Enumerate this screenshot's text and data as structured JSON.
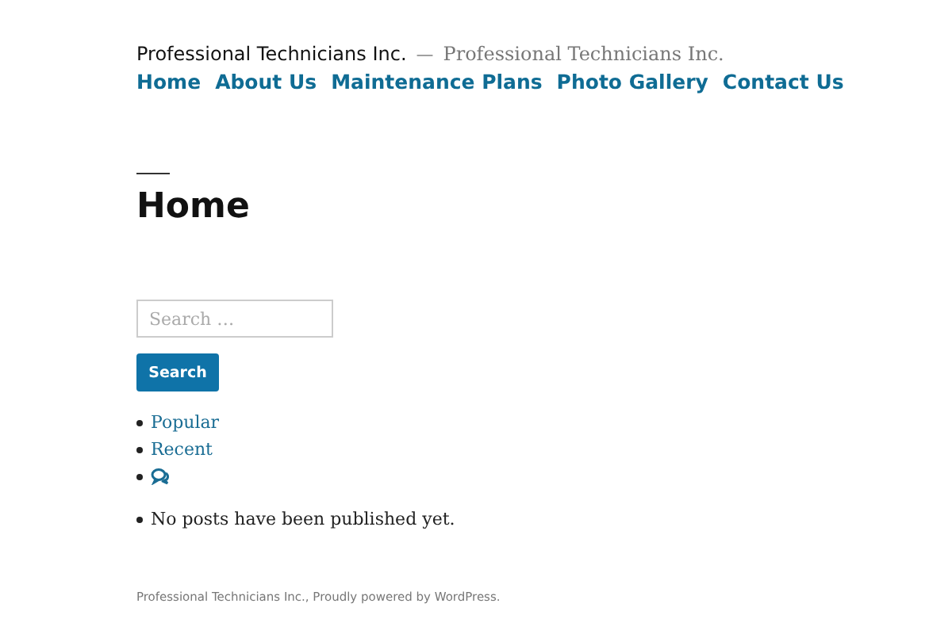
{
  "header": {
    "site_title": "Professional Technicians Inc.",
    "separator": "—",
    "tagline": "Professional Technicians Inc."
  },
  "nav": [
    {
      "label": "Home"
    },
    {
      "label": "About Us"
    },
    {
      "label": "Maintenance Plans"
    },
    {
      "label": "Photo Gallery"
    },
    {
      "label": "Contact Us"
    }
  ],
  "page_title": "Home",
  "search": {
    "placeholder": "Search …",
    "button": "Search"
  },
  "tabs": [
    {
      "kind": "link",
      "label": "Popular"
    },
    {
      "kind": "link",
      "label": "Recent"
    },
    {
      "kind": "icon"
    }
  ],
  "posts": [
    "No posts have been published yet."
  ],
  "footer": "Professional Technicians Inc., Proudly powered by WordPress."
}
